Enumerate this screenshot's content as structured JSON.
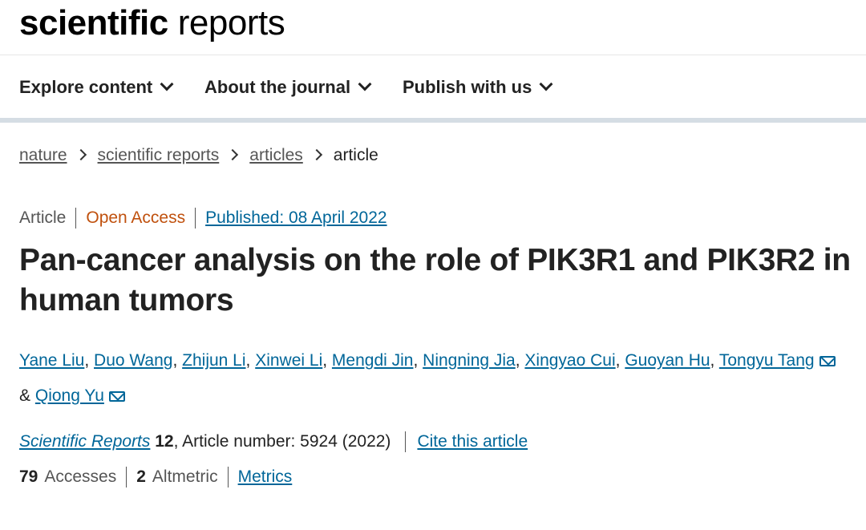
{
  "site": {
    "logo_bold": "scientific",
    "logo_regular": "reports"
  },
  "nav": {
    "items": [
      {
        "label": "Explore content"
      },
      {
        "label": "About the journal"
      },
      {
        "label": "Publish with us"
      }
    ]
  },
  "breadcrumb": {
    "items": [
      "nature",
      "scientific reports",
      "articles"
    ],
    "current": "article"
  },
  "article": {
    "type": "Article",
    "access": "Open Access",
    "published": "Published: 08 April 2022",
    "title": "Pan-cancer analysis on the role of PIK3R1 and PIK3R2 in human tumors",
    "authors": [
      "Yane Liu",
      "Duo Wang",
      "Zhijun Li",
      "Xinwei Li",
      "Mengdi Jin",
      "Ningning Jia",
      "Xingyao Cui",
      "Guoyan Hu",
      "Tongyu Tang",
      "Qiong Yu"
    ],
    "author_joiner": "&",
    "journal": "Scientific Reports",
    "volume": "12",
    "article_number": ", Article number: 5924 (2022)",
    "cite_label": "Cite this article",
    "accesses_count": "79",
    "accesses_label": "Accesses",
    "altmetric_count": "2",
    "altmetric_label": "Altmetric",
    "metrics_label": "Metrics"
  },
  "colors": {
    "link": "#006699",
    "open_access": "#c0510e",
    "nav_rule": "#d5dde4"
  },
  "icons": {
    "nav_chevron": "chevron-down-icon",
    "breadcrumb_separator": "chevron-right-icon",
    "corresponding_author": "envelope-icon"
  }
}
